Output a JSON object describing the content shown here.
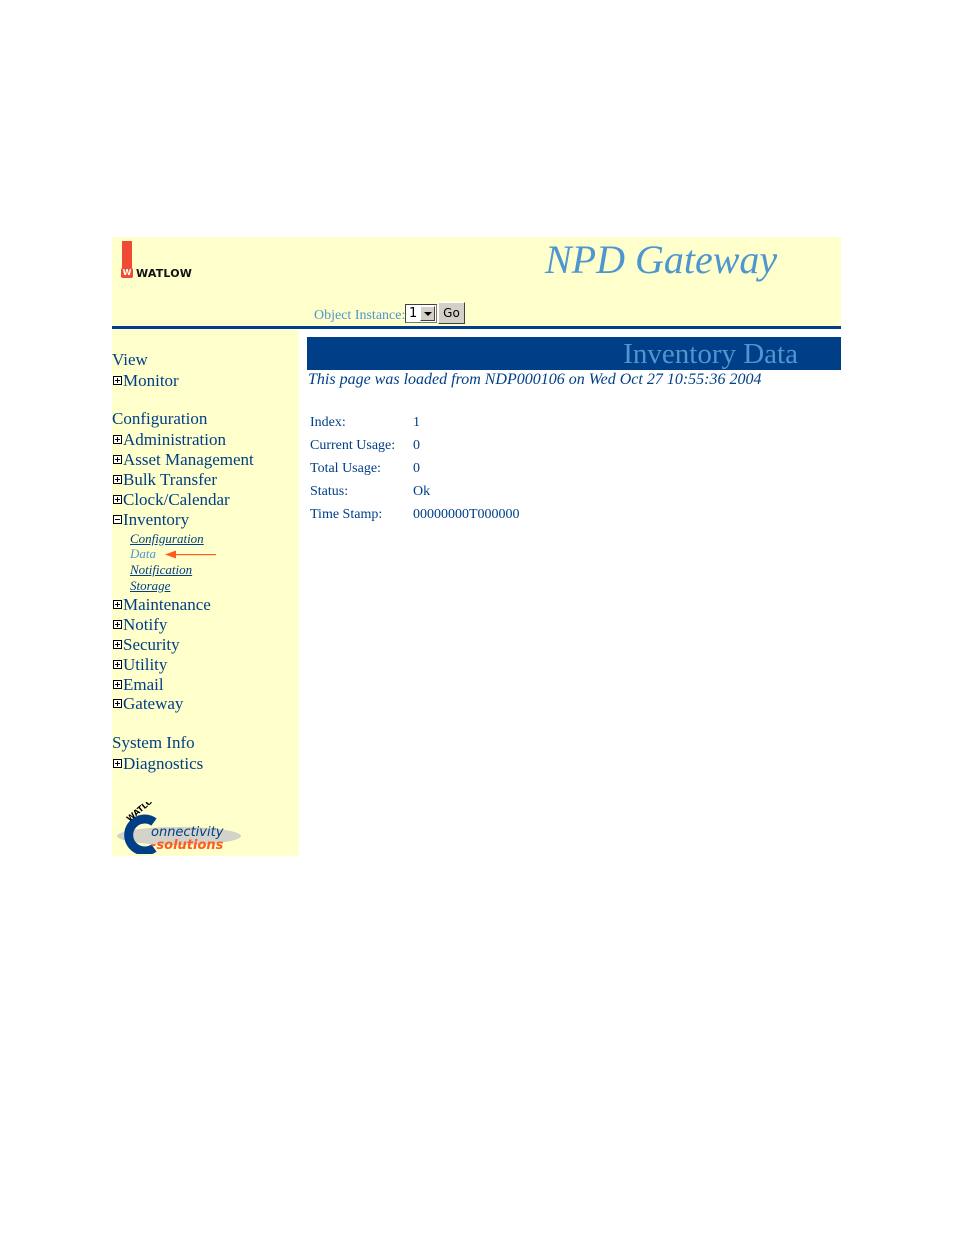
{
  "header": {
    "logo_text": "WATLOW",
    "app_title": "NPD Gateway",
    "object_instance_label": "Object Instance:",
    "object_instance_value": "1",
    "go_label": "Go",
    "brand_color": "#003f87",
    "accent_color": "#4d96cf",
    "logo_red": "#ef4a32"
  },
  "sidebar": {
    "sections": [
      {
        "heading": "View",
        "items": [
          {
            "label": "Monitor",
            "expanded": false
          }
        ]
      },
      {
        "heading": "Configuration",
        "items": [
          {
            "label": "Administration",
            "expanded": false
          },
          {
            "label": "Asset Management",
            "expanded": false
          },
          {
            "label": "Bulk Transfer",
            "expanded": false
          },
          {
            "label": "Clock/Calendar",
            "expanded": false
          },
          {
            "label": "Inventory",
            "expanded": true,
            "children": [
              {
                "label": "Configuration",
                "active": false
              },
              {
                "label": "Data",
                "active": true
              },
              {
                "label": "Notification",
                "active": false
              },
              {
                "label": "Storage",
                "active": false
              }
            ]
          },
          {
            "label": "Maintenance",
            "expanded": false
          },
          {
            "label": "Notify",
            "expanded": false
          },
          {
            "label": "Security",
            "expanded": false
          },
          {
            "label": "Utility",
            "expanded": false
          },
          {
            "label": "Email",
            "expanded": false
          },
          {
            "label": "Gateway",
            "expanded": false
          }
        ]
      },
      {
        "heading": "System Info",
        "items": [
          {
            "label": "Diagnostics",
            "expanded": false
          }
        ]
      }
    ],
    "footer_logo": {
      "top_text": "WATLOW",
      "line1": "onnectivity",
      "line2": "-solutions"
    }
  },
  "main": {
    "title": "Inventory Data",
    "load_info": "This page was loaded from NDP000106 on Wed Oct 27 10:55:36 2004",
    "fields": [
      {
        "label": "Index:",
        "value": "1"
      },
      {
        "label": "Current Usage:",
        "value": "0"
      },
      {
        "label": "Total Usage:",
        "value": "0"
      },
      {
        "label": "Status:",
        "value": "Ok"
      },
      {
        "label": "Time Stamp:",
        "value": "00000000T000000"
      }
    ]
  }
}
